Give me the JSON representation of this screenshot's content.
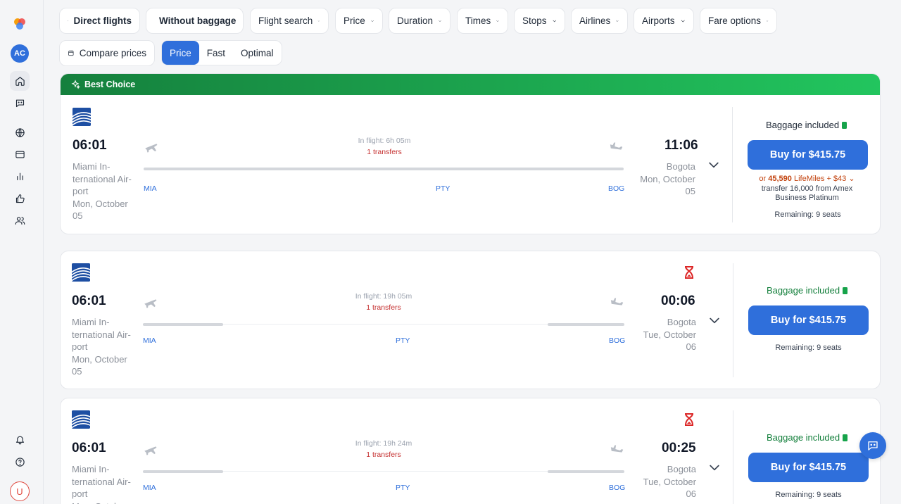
{
  "sidebar": {
    "avatar_initials": "AC",
    "user_initial": "U"
  },
  "filters": {
    "direct_flights": "Direct flights",
    "without_baggage": "Without baggage",
    "flight_search": "Flight search",
    "price": "Price",
    "duration": "Duration",
    "times": "Times",
    "stops": "Stops",
    "airlines": "Airlines",
    "airports": "Airports",
    "fare_options": "Fare options"
  },
  "sort": {
    "compare_prices": "Compare prices",
    "price": "Price",
    "fast": "Fast",
    "optimal": "Optimal",
    "active": "Price"
  },
  "best_choice_label": "Best Choice",
  "flights": [
    {
      "dep_time": "06:01",
      "dep_place": [
        "Miami In-",
        "ternational Air-",
        "port",
        "Mon, October",
        "05"
      ],
      "arr_time": "11:06",
      "arr_place": [
        "Bogota",
        "Mon, October",
        "05"
      ],
      "in_flight": "In flight: 6h 05m",
      "transfers": "1 transfers",
      "codes": [
        "MIA",
        "PTY",
        "BOG"
      ],
      "baggage": "Baggage included",
      "buy": "Buy for $415.75",
      "miles_or": "or",
      "miles_amount": "45,590",
      "miles_program": "LifeMiles + $43",
      "miles_line2": "transfer 16,000 from Amex",
      "miles_line3": "Business Platinum",
      "remaining": "Remaining: 9 seats",
      "segment1": 0.65,
      "segment2": 0.34
    },
    {
      "dep_time": "06:01",
      "dep_place": [
        "Miami In-",
        "ternational Air-",
        "port",
        "Mon, October",
        "05"
      ],
      "arr_time": "00:06",
      "arr_place": [
        "Bogota",
        "Tue, October",
        "06"
      ],
      "in_flight": "In flight: 19h 05m",
      "transfers": "1 transfers",
      "codes": [
        "MIA",
        "PTY",
        "BOG"
      ],
      "baggage": "Baggage included",
      "buy": "Buy for $415.75",
      "remaining": "Remaining: 9 seats",
      "segment1": 0.2,
      "segment2": 0.1
    },
    {
      "dep_time": "06:01",
      "dep_place": [
        "Miami In-",
        "ternational Air-",
        "port",
        "Mon, Octob"
      ],
      "arr_time": "00:25",
      "arr_place": [
        "Bogota",
        "Tue, October",
        "06"
      ],
      "in_flight": "In flight: 19h 24m",
      "transfers": "1 transfers",
      "codes": [
        "MIA",
        "PTY",
        "BOG"
      ],
      "baggage": "Baggage included",
      "buy": "Buy for $415.75",
      "remaining": "Remaining: 9 seats",
      "segment1": 0.2,
      "segment2": 0.1
    }
  ]
}
